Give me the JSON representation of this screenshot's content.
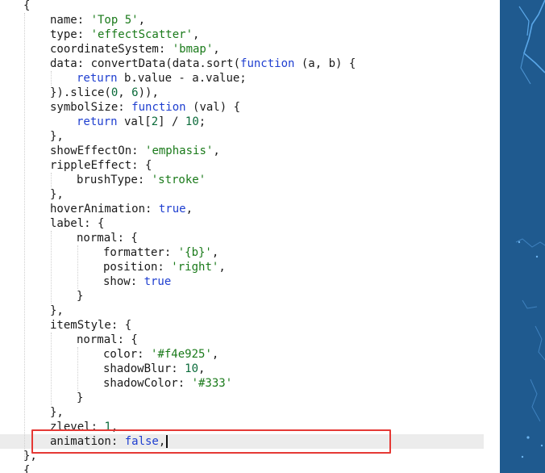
{
  "editor": {
    "lines": [
      {
        "indent": 0,
        "tokens": [
          {
            "t": "{",
            "c": "p"
          }
        ]
      },
      {
        "indent": 1,
        "tokens": [
          {
            "t": "name: ",
            "c": "prop"
          },
          {
            "t": "'Top 5'",
            "c": "str"
          },
          {
            "t": ",",
            "c": "p"
          }
        ]
      },
      {
        "indent": 1,
        "tokens": [
          {
            "t": "type: ",
            "c": "prop"
          },
          {
            "t": "'effectScatter'",
            "c": "str"
          },
          {
            "t": ",",
            "c": "p"
          }
        ]
      },
      {
        "indent": 1,
        "tokens": [
          {
            "t": "coordinateSystem: ",
            "c": "prop"
          },
          {
            "t": "'bmap'",
            "c": "str"
          },
          {
            "t": ",",
            "c": "p"
          }
        ]
      },
      {
        "indent": 1,
        "tokens": [
          {
            "t": "data: convertData(data.sort(",
            "c": "prop"
          },
          {
            "t": "function",
            "c": "kw"
          },
          {
            "t": " (a, b) {",
            "c": "p"
          }
        ]
      },
      {
        "indent": 2,
        "tokens": [
          {
            "t": "return",
            "c": "kw"
          },
          {
            "t": " b.value - a.value;",
            "c": "p"
          }
        ]
      },
      {
        "indent": 1,
        "tokens": [
          {
            "t": "}).slice(",
            "c": "p"
          },
          {
            "t": "0",
            "c": "num"
          },
          {
            "t": ", ",
            "c": "p"
          },
          {
            "t": "6",
            "c": "num"
          },
          {
            "t": ")),",
            "c": "p"
          }
        ]
      },
      {
        "indent": 1,
        "tokens": [
          {
            "t": "symbolSize: ",
            "c": "prop"
          },
          {
            "t": "function",
            "c": "kw"
          },
          {
            "t": " (val) {",
            "c": "p"
          }
        ]
      },
      {
        "indent": 2,
        "tokens": [
          {
            "t": "return",
            "c": "kw"
          },
          {
            "t": " val[",
            "c": "p"
          },
          {
            "t": "2",
            "c": "num"
          },
          {
            "t": "] / ",
            "c": "p"
          },
          {
            "t": "10",
            "c": "num"
          },
          {
            "t": ";",
            "c": "p"
          }
        ]
      },
      {
        "indent": 1,
        "tokens": [
          {
            "t": "},",
            "c": "p"
          }
        ]
      },
      {
        "indent": 1,
        "tokens": [
          {
            "t": "showEffectOn: ",
            "c": "prop"
          },
          {
            "t": "'emphasis'",
            "c": "str"
          },
          {
            "t": ",",
            "c": "p"
          }
        ]
      },
      {
        "indent": 1,
        "tokens": [
          {
            "t": "rippleEffect: {",
            "c": "prop"
          }
        ]
      },
      {
        "indent": 2,
        "tokens": [
          {
            "t": "brushType: ",
            "c": "prop"
          },
          {
            "t": "'stroke'",
            "c": "str"
          }
        ]
      },
      {
        "indent": 1,
        "tokens": [
          {
            "t": "},",
            "c": "p"
          }
        ]
      },
      {
        "indent": 1,
        "tokens": [
          {
            "t": "hoverAnimation: ",
            "c": "prop"
          },
          {
            "t": "true",
            "c": "kw"
          },
          {
            "t": ",",
            "c": "p"
          }
        ]
      },
      {
        "indent": 1,
        "tokens": [
          {
            "t": "label: {",
            "c": "prop"
          }
        ]
      },
      {
        "indent": 2,
        "tokens": [
          {
            "t": "normal: {",
            "c": "prop"
          }
        ]
      },
      {
        "indent": 3,
        "tokens": [
          {
            "t": "formatter: ",
            "c": "prop"
          },
          {
            "t": "'{b}'",
            "c": "str"
          },
          {
            "t": ",",
            "c": "p"
          }
        ]
      },
      {
        "indent": 3,
        "tokens": [
          {
            "t": "position: ",
            "c": "prop"
          },
          {
            "t": "'right'",
            "c": "str"
          },
          {
            "t": ",",
            "c": "p"
          }
        ]
      },
      {
        "indent": 3,
        "tokens": [
          {
            "t": "show: ",
            "c": "prop"
          },
          {
            "t": "true",
            "c": "kw"
          }
        ]
      },
      {
        "indent": 2,
        "tokens": [
          {
            "t": "}",
            "c": "p"
          }
        ]
      },
      {
        "indent": 1,
        "tokens": [
          {
            "t": "},",
            "c": "p"
          }
        ]
      },
      {
        "indent": 1,
        "tokens": [
          {
            "t": "itemStyle: {",
            "c": "prop"
          }
        ]
      },
      {
        "indent": 2,
        "tokens": [
          {
            "t": "normal: {",
            "c": "prop"
          }
        ]
      },
      {
        "indent": 3,
        "tokens": [
          {
            "t": "color: ",
            "c": "prop"
          },
          {
            "t": "'#f4e925'",
            "c": "str"
          },
          {
            "t": ",",
            "c": "p"
          }
        ]
      },
      {
        "indent": 3,
        "tokens": [
          {
            "t": "shadowBlur: ",
            "c": "prop"
          },
          {
            "t": "10",
            "c": "num"
          },
          {
            "t": ",",
            "c": "p"
          }
        ]
      },
      {
        "indent": 3,
        "tokens": [
          {
            "t": "shadowColor: ",
            "c": "prop"
          },
          {
            "t": "'#333'",
            "c": "str"
          }
        ]
      },
      {
        "indent": 2,
        "tokens": [
          {
            "t": "}",
            "c": "p"
          }
        ]
      },
      {
        "indent": 1,
        "tokens": [
          {
            "t": "},",
            "c": "p"
          }
        ]
      },
      {
        "indent": 1,
        "tokens": [
          {
            "t": "zlevel: ",
            "c": "prop"
          },
          {
            "t": "1",
            "c": "num"
          },
          {
            "t": ",",
            "c": "p"
          }
        ]
      },
      {
        "indent": 1,
        "current": true,
        "tokens": [
          {
            "t": "animation: ",
            "c": "prop"
          },
          {
            "t": "false",
            "c": "kw"
          },
          {
            "t": ",",
            "c": "p"
          }
        ]
      },
      {
        "indent": 0,
        "tokens": [
          {
            "t": "},",
            "c": "p"
          }
        ]
      },
      {
        "indent": 0,
        "tokens": [
          {
            "t": "{",
            "c": "p"
          }
        ]
      }
    ]
  },
  "colors": {
    "string": "#1a7a1a",
    "keyword": "#1f3fd0",
    "number": "#0b6b3a",
    "text": "#1a1a1a",
    "current_line": "#ececec",
    "highlight_border": "#e53935",
    "map_background": "#1f5a8f"
  },
  "map_preview": {
    "icon": "map-preview"
  }
}
